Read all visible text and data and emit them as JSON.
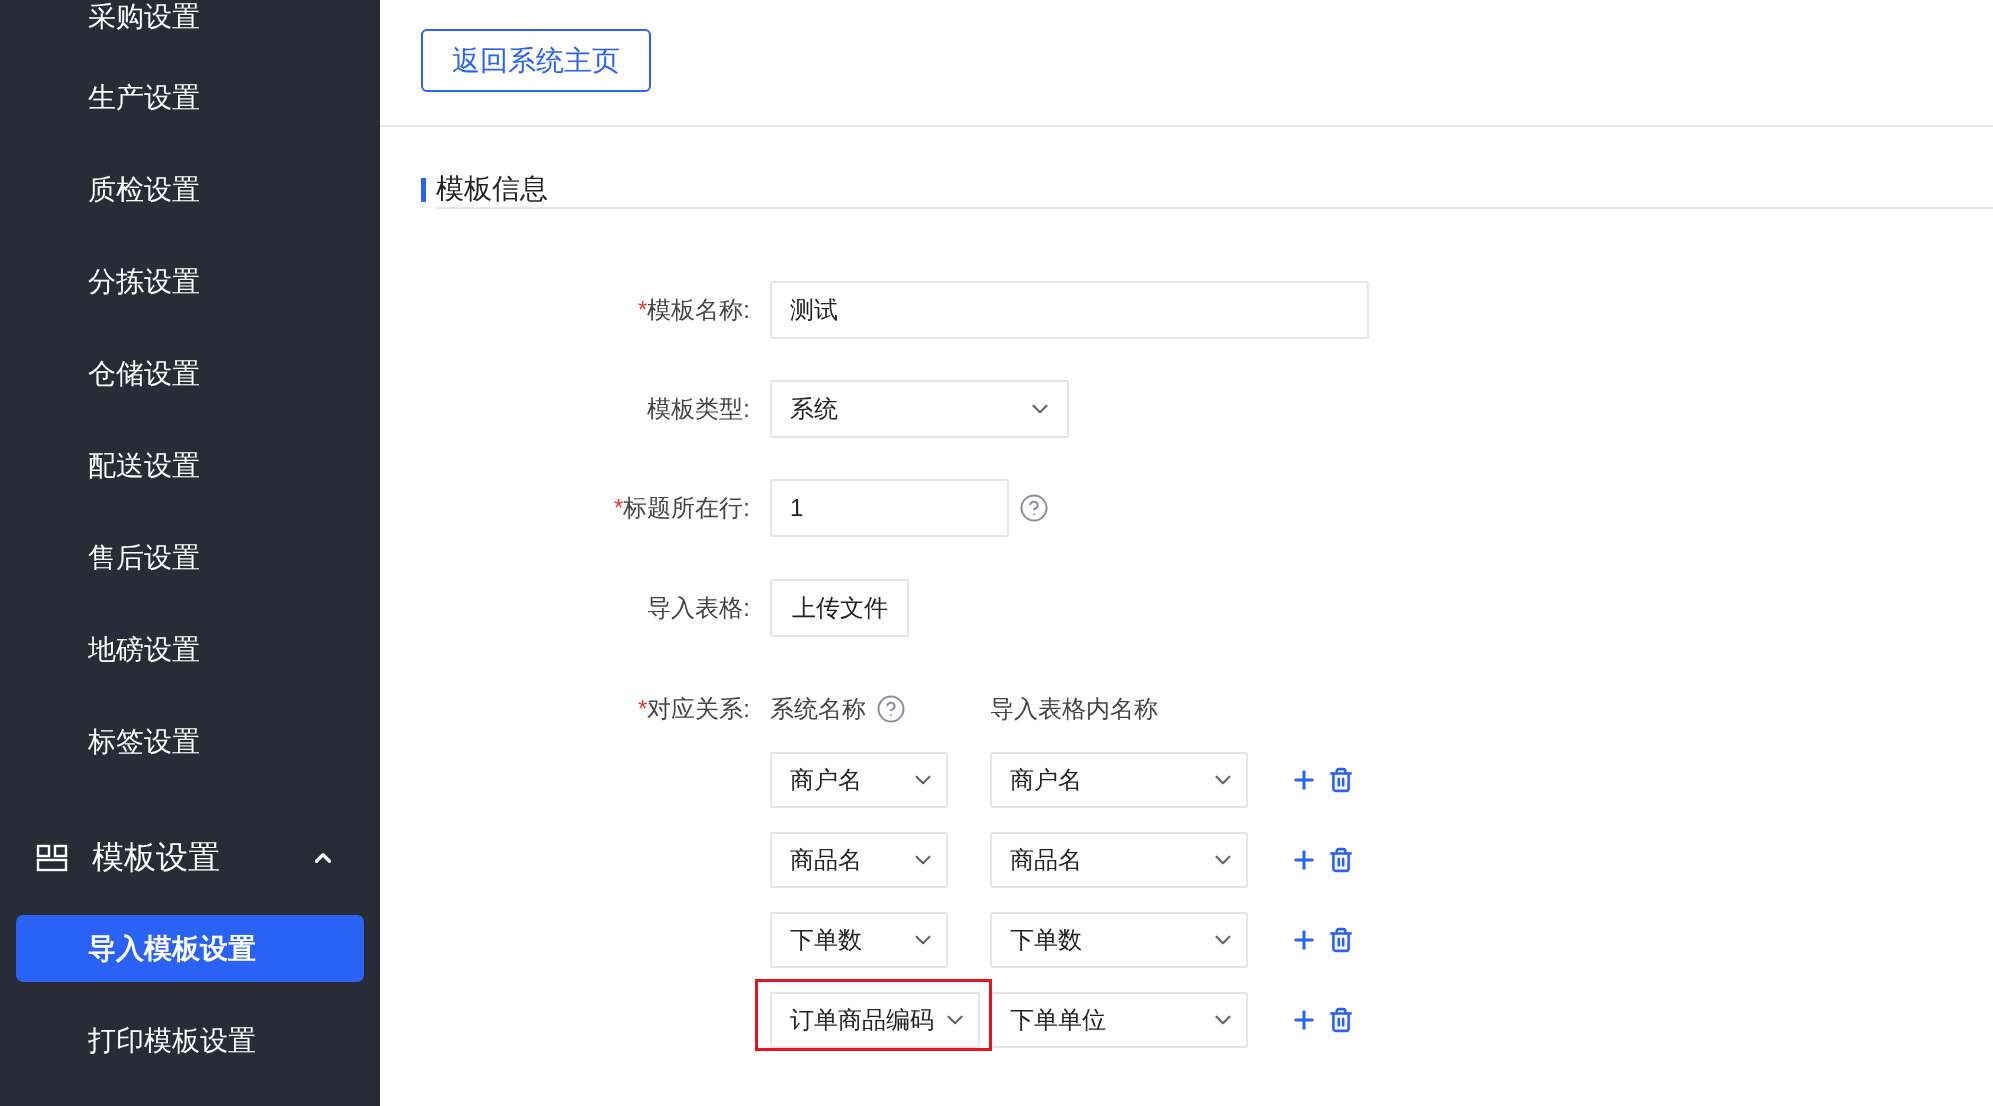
{
  "sidebar": {
    "items": [
      {
        "label": "采购设置",
        "selected": false
      },
      {
        "label": "生产设置",
        "selected": false
      },
      {
        "label": "质检设置",
        "selected": false
      },
      {
        "label": "分拣设置",
        "selected": false
      },
      {
        "label": "仓储设置",
        "selected": false
      },
      {
        "label": "配送设置",
        "selected": false
      },
      {
        "label": "售后设置",
        "selected": false
      },
      {
        "label": "地磅设置",
        "selected": false
      },
      {
        "label": "标签设置",
        "selected": false
      }
    ],
    "group": {
      "label": "模板设置",
      "expanded": true,
      "children": [
        {
          "label": "导入模板设置",
          "selected": true
        },
        {
          "label": "打印模板设置",
          "selected": false
        }
      ]
    }
  },
  "back_button": "返回系统主页",
  "section_title": "模板信息",
  "form": {
    "fields": [
      {
        "kind": "text",
        "required_mark": "*",
        "label": "模板名称:",
        "value": "测试"
      },
      {
        "kind": "select",
        "label": "模板类型:",
        "value": "系统"
      },
      {
        "kind": "number",
        "required_mark": "*",
        "label": "标题所在行:",
        "value": "1",
        "help": true
      },
      {
        "kind": "upload",
        "label": "导入表格:",
        "button": "上传文件"
      }
    ],
    "mapping": {
      "required_mark": "*",
      "label": "对应关系:",
      "system_header": "系统名称",
      "system_help": true,
      "import_header": "导入表格内名称",
      "rows": [
        {
          "system": "商户名",
          "import": "商户名",
          "highlighted": false
        },
        {
          "system": "商品名",
          "import": "商品名",
          "highlighted": false
        },
        {
          "system": "下单数",
          "import": "下单数",
          "highlighted": false
        },
        {
          "system": "订单商品编码",
          "import": "下单单位",
          "highlighted": true
        }
      ]
    }
  }
}
